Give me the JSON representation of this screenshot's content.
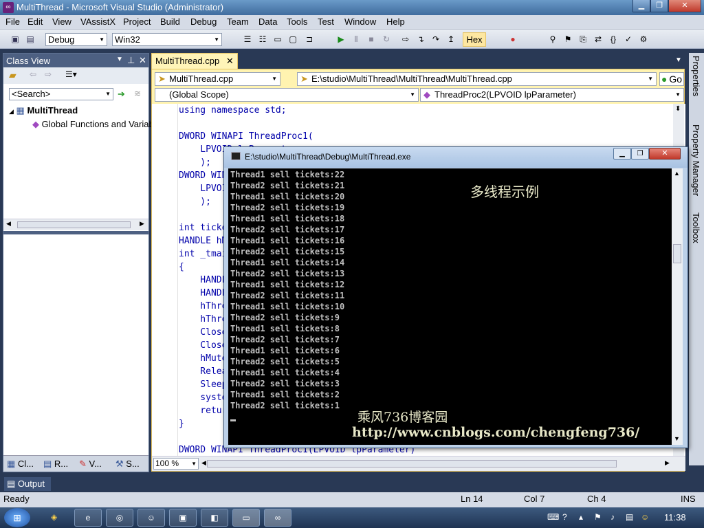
{
  "window": {
    "title": "MultiThread - Microsoft Visual Studio (Administrator)",
    "app_icon": "vs-icon"
  },
  "menu": [
    "File",
    "Edit",
    "View",
    "VAssistX",
    "Project",
    "Build",
    "Debug",
    "Team",
    "Data",
    "Tools",
    "Test",
    "Window",
    "Help"
  ],
  "toolbar": {
    "config": "Debug",
    "platform": "Win32",
    "hex_label": "Hex"
  },
  "class_view": {
    "title": "Class View",
    "search_placeholder": "<Search>",
    "tree": {
      "root": "MultiThread",
      "child": "Global Functions and Variables"
    },
    "bottom_tabs": [
      "Cl...",
      "R...",
      "V...",
      "S..."
    ]
  },
  "editor": {
    "tab": "MultiThread.cpp",
    "nav_file": "MultiThread.cpp",
    "nav_path": "E:\\studio\\MultiThread\\MultiThread\\MultiThread.cpp",
    "go_label": "Go",
    "scope": "(Global Scope)",
    "function": "ThreadProc2(LPVOID lpParameter)",
    "zoom": "100 %",
    "code_lines": [
      "using namespace std;",
      "",
      "DWORD WINAPI ThreadProc1(",
      "    LPVOID lpParameter",
      "    );",
      "DWORD WINAPI ThreadProc2(",
      "    LPVOID lpParameter",
      "    );",
      "",
      "int tickets=100;",
      "HANDLE hMutex;",
      "int _tmain(int argc, _TCHAR* argv[])",
      "{",
      "    HANDLE hThread1;",
      "    HANDLE hThread2;",
      "    hThread1=CreateThread(",
      "    hThread2=CreateThread(",
      "    CloseHandle(hThread1);",
      "    CloseHandle(hThread2);",
      "    hMutex=CreateMutex(",
      "    ReleaseMutex(hMutex);",
      "    Sleep(4000);",
      "    system(\"pause\");",
      "    return 0;",
      "}",
      "",
      "DWORD WINAPI ThreadProc1(LPVOID lpParameter)"
    ]
  },
  "right_dock": [
    "Properties",
    "Property Manager",
    "Toolbox"
  ],
  "console": {
    "title": "E:\\studio\\MultiThread\\Debug\\MultiThread.exe",
    "lines": [
      "Thread1 sell tickets:22",
      "Thread2 sell tickets:21",
      "Thread1 sell tickets:20",
      "Thread2 sell tickets:19",
      "Thread1 sell tickets:18",
      "Thread2 sell tickets:17",
      "Thread1 sell tickets:16",
      "Thread2 sell tickets:15",
      "Thread1 sell tickets:14",
      "Thread2 sell tickets:13",
      "Thread1 sell tickets:12",
      "Thread2 sell tickets:11",
      "Thread1 sell tickets:10",
      "Thread2 sell tickets:9",
      "Thread1 sell tickets:8",
      "Thread2 sell tickets:7",
      "Thread1 sell tickets:6",
      "Thread2 sell tickets:5",
      "Thread1 sell tickets:4",
      "Thread2 sell tickets:3",
      "Thread1 sell tickets:2",
      "Thread2 sell tickets:1"
    ],
    "overlay_title": "多线程示例",
    "overlay_blog": "乘风736博客园",
    "overlay_url": "http://www.cnblogs.com/chengfeng736/"
  },
  "output_label": "Output",
  "status": {
    "ready": "Ready",
    "ln": "Ln 14",
    "col": "Col 7",
    "ch": "Ch 4",
    "ins": "INS"
  },
  "taskbar": {
    "time": "11:38"
  }
}
